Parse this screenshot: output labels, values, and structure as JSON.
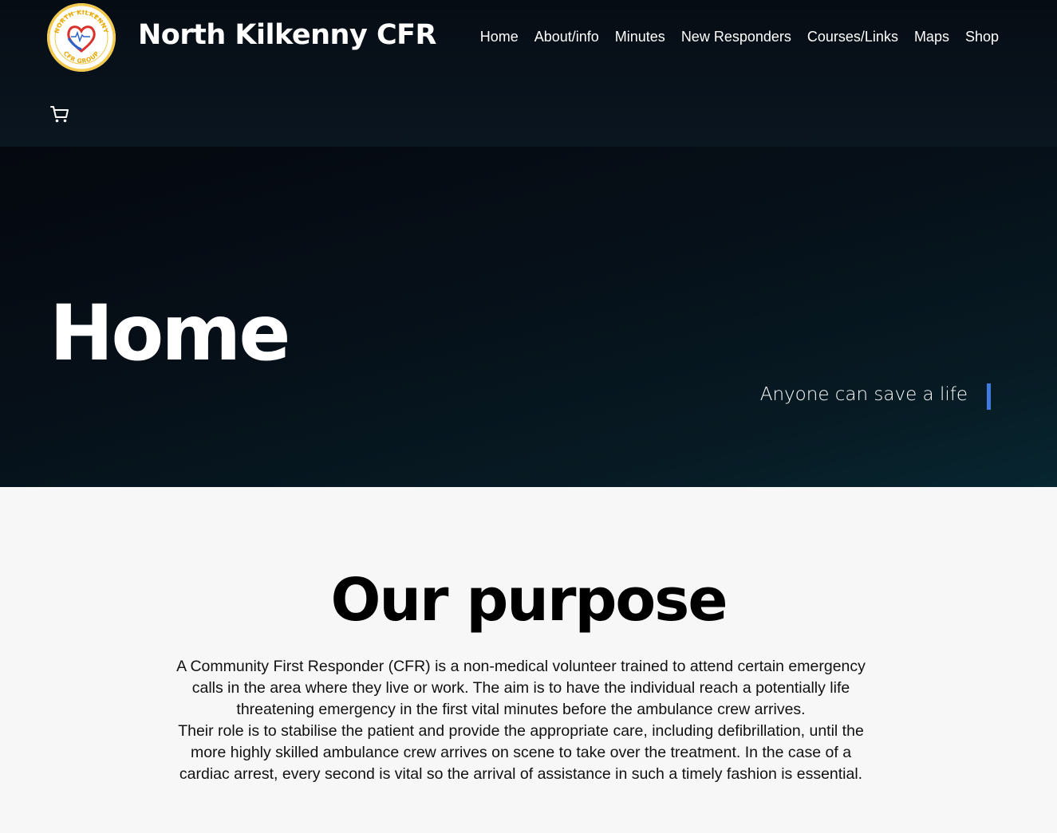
{
  "header": {
    "brand": "North Kilkenny CFR",
    "logo": {
      "ring_top_text": "NORTH KILKENNY",
      "ring_bottom_text": "CFR GROUP"
    },
    "nav": [
      {
        "label": "Home"
      },
      {
        "label": "About/info"
      },
      {
        "label": "Minutes"
      },
      {
        "label": "New Responders"
      },
      {
        "label": "Courses/Links"
      },
      {
        "label": "Maps"
      },
      {
        "label": "Shop"
      }
    ],
    "cart_icon": "cart-icon"
  },
  "hero": {
    "title": "Home",
    "tagline": "Anyone can save a life",
    "accent_color": "#3f7ae0"
  },
  "purpose": {
    "title": "Our purpose",
    "paragraph_1": "A Community First Responder (CFR) is a non-medical volunteer trained to attend certain emergency calls in the area where they live or work. The aim is to have the individual reach a potentially life threatening emergency in the first vital minutes before the ambulance crew arrives.",
    "paragraph_2": "Their role is to stabilise the patient and provide the appropriate care, including defibrillation, until the more highly skilled ambulance crew arrives on scene to take over the treatment. In the case of a cardiac arrest, every second is vital so the arrival of assistance in such a timely fashion is essential."
  }
}
